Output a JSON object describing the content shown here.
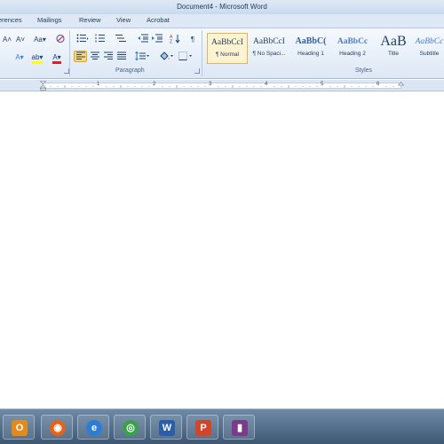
{
  "window": {
    "title": "Document4 - Microsoft Word"
  },
  "tabs": [
    "erences",
    "Mailings",
    "Review",
    "View",
    "Acrobat"
  ],
  "ribbon": {
    "font_group": {
      "grow_font": "A˄",
      "shrink_font": "A˅",
      "change_case": "Aa▾",
      "clear_formatting": "✒",
      "text_effects": "A▾",
      "highlight": "ab▾",
      "font_color": "A▾"
    },
    "paragraph_group": {
      "label": "Paragraph",
      "pilcrow": "¶"
    },
    "styles_group": {
      "label": "Styles",
      "items": [
        {
          "sample": "AaBbCcI",
          "name": "¶ Normal",
          "selected": true
        },
        {
          "sample": "AaBbCcI",
          "name": "¶ No Spaci...",
          "selected": false
        },
        {
          "sample": "AaBbC(",
          "name": "Heading 1",
          "selected": false
        },
        {
          "sample": "AaBbCc",
          "name": "Heading 2",
          "selected": false
        },
        {
          "sample": "AaB",
          "name": "Title",
          "selected": false
        },
        {
          "sample": "AaBbCc",
          "name": "Subtitle",
          "selected": false
        }
      ]
    }
  },
  "ruler": {
    "numbers": [
      "1",
      "2",
      "3",
      "4",
      "5",
      "6"
    ]
  },
  "taskbar": {
    "apps": [
      {
        "icon": "outlook-icon",
        "glyph": "O",
        "color": "#e38a1b"
      },
      {
        "icon": "firefox-icon",
        "glyph": "◉",
        "color": "#e4621c"
      },
      {
        "icon": "internet-explorer-icon",
        "glyph": "e",
        "color": "#2d7cd6"
      },
      {
        "icon": "chrome-icon",
        "glyph": "◎",
        "color": "#3aa04a"
      },
      {
        "icon": "word-icon",
        "glyph": "W",
        "color": "#2a5ea8"
      },
      {
        "icon": "powerpoint-icon",
        "glyph": "P",
        "color": "#d1452a"
      },
      {
        "icon": "app-icon",
        "glyph": "▮",
        "color": "#7b3a8c"
      }
    ]
  },
  "colors": {
    "highlight_yellow": "#ffff00",
    "font_red": "#e02020",
    "accent": "#fbd97a"
  }
}
